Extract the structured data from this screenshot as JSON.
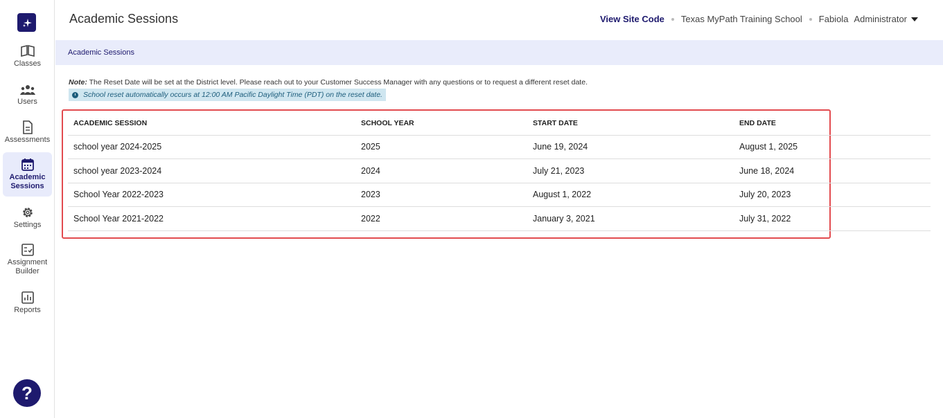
{
  "header": {
    "title": "Academic Sessions",
    "view_site_code": "View Site Code",
    "school": "Texas MyPath Training School",
    "user_name": "Fabiola",
    "user_role": "Administrator"
  },
  "sidebar": {
    "items": [
      {
        "label": "Classes",
        "icon": "book-icon"
      },
      {
        "label": "Users",
        "icon": "users-icon"
      },
      {
        "label": "Assessments",
        "icon": "document-icon"
      },
      {
        "label": "Academic Sessions",
        "icon": "calendar-icon",
        "active": true
      },
      {
        "label": "Settings",
        "icon": "gear-icon"
      },
      {
        "label": "Assignment Builder",
        "icon": "checklist-icon"
      },
      {
        "label": "Reports",
        "icon": "bar-chart-icon"
      }
    ],
    "help_label": "?"
  },
  "breadcrumb": "Academic Sessions",
  "note": {
    "label": "Note:",
    "text": " The Reset Date will be set at the District level. Please reach out to your Customer Success Manager with any questions or to request a different reset date.",
    "reset_info": "School reset automatically occurs at 12:00 AM Pacific Daylight Time (PDT) on the reset date."
  },
  "table": {
    "headers": [
      "ACADEMIC SESSION",
      "SCHOOL YEAR",
      "START DATE",
      "END DATE"
    ],
    "rows": [
      [
        "school year 2024-2025",
        "2025",
        "June 19, 2024",
        "August 1, 2025"
      ],
      [
        "school year 2023-2024",
        "2024",
        "July 21, 2023",
        "June 18, 2024"
      ],
      [
        "School Year 2022-2023",
        "2023",
        "August 1, 2022",
        "July 20, 2023"
      ],
      [
        "School Year 2021-2022",
        "2022",
        "January 3, 2021",
        "July 31, 2022"
      ]
    ]
  },
  "colors": {
    "brand": "#1e1a6e",
    "highlight": "#e24b4f",
    "crumb_bg": "#e9ecfb"
  }
}
